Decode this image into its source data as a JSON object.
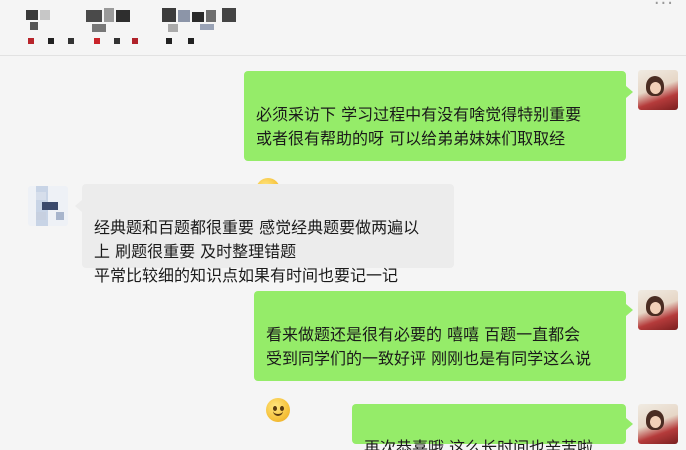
{
  "header": {
    "title_mosaic_icon": "pixelated-contact-name",
    "menu_icon": "more-dots-icon",
    "menu_glyph": "···"
  },
  "messages": [
    {
      "sender": "me",
      "text": "必须采访下  学习过程中有没有啥觉得特别重要\n 或者很有帮助的呀  可以给弟弟妹妹们取取经",
      "emoji": "hug-emoji"
    },
    {
      "sender": "other",
      "text": "经典题和百题都很重要 感觉经典题要做两遍以\n上 刷题很重要 及时整理错题\n平常比较细的知识点如果有时间也要记一记"
    },
    {
      "sender": "me",
      "text": "看来做题还是很有必要的  嘻嘻  百题一直都会\n受到同学们的一致好评 刚刚也是有同学这么说",
      "emoji": "thinking-emoji"
    },
    {
      "sender": "me",
      "text": "再次恭喜哦  这么长时间也辛苦啦"
    }
  ],
  "colors": {
    "background": "#f5f5f5",
    "my_bubble": "#95ec69",
    "other_bubble": "#ececec"
  }
}
